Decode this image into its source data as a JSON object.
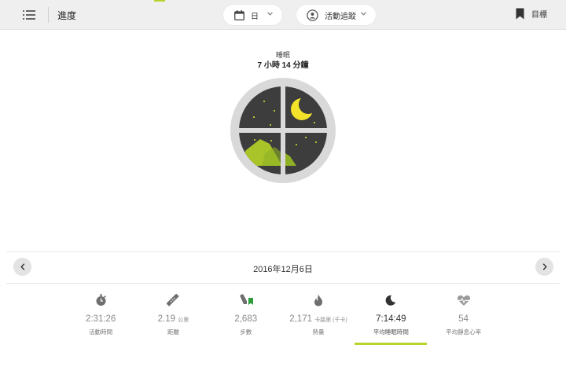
{
  "header": {
    "menu_icon": "hamburger-menu-icon",
    "title": "進度",
    "date_selector": {
      "icon": "calendar-icon",
      "label": "日"
    },
    "tracking_selector": {
      "icon": "activity-tracker-icon",
      "label": "活動追蹤"
    },
    "goal": {
      "icon": "bookmark-icon",
      "label": "目標"
    }
  },
  "main": {
    "label": "睡眠",
    "value": "7 小時 14 分鐘"
  },
  "date_bar": {
    "prev_icon": "chevron-left-icon",
    "date": "2016年12月6日",
    "next_icon": "chevron-right-icon"
  },
  "stats": [
    {
      "icon": "stopwatch-icon",
      "value": "2:31:26",
      "unit": "",
      "label": "活動時間",
      "active": false
    },
    {
      "icon": "ruler-icon",
      "value": "2.19",
      "unit": "公里",
      "label": "距離",
      "active": false
    },
    {
      "icon": "shoe-goal-icon",
      "value": "2,683",
      "unit": "",
      "label": "步數",
      "active": false
    },
    {
      "icon": "flame-icon",
      "value": "2,171",
      "unit": "卡路里 (千卡)",
      "label": "熱量",
      "active": false
    },
    {
      "icon": "moon-icon",
      "value": "7:14:49",
      "unit": "",
      "label": "平均睡眠時間",
      "active": true
    },
    {
      "icon": "heart-rate-icon",
      "value": "54",
      "unit": "",
      "label": "平均靜息心率",
      "active": false
    }
  ],
  "colors": {
    "accent": "#b8d42c",
    "header_bg": "#efefef",
    "night_sky": "#3d3d3d",
    "moon": "#f2e22a",
    "window_frame": "#d9d9d9"
  }
}
